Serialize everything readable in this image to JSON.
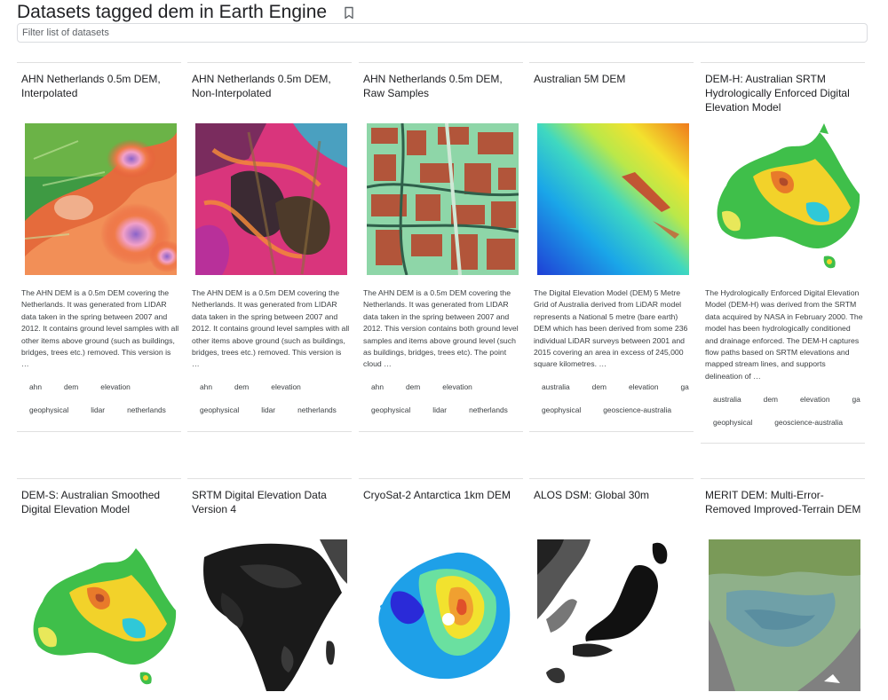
{
  "page": {
    "title": "Datasets tagged dem in Earth Engine"
  },
  "filter": {
    "placeholder": "Filter list of datasets"
  },
  "cards": [
    {
      "title": "AHN Netherlands 0.5m DEM, Interpolated",
      "description": "The AHN DEM is a 0.5m DEM covering the Netherlands. It was generated from LIDAR data taken in the spring between 2007 and 2012. It contains ground level samples with all other items above ground (such as buildings, bridges, trees etc.) removed. This version is …",
      "tags": [
        "ahn",
        "dem",
        "elevation",
        "geophysical",
        "lidar",
        "netherlands"
      ]
    },
    {
      "title": "AHN Netherlands 0.5m DEM, Non-Interpolated",
      "description": "The AHN DEM is a 0.5m DEM covering the Netherlands. It was generated from LIDAR data taken in the spring between 2007 and 2012. It contains ground level samples with all other items above ground (such as buildings, bridges, trees etc.) removed. This version is …",
      "tags": [
        "ahn",
        "dem",
        "elevation",
        "geophysical",
        "lidar",
        "netherlands"
      ]
    },
    {
      "title": "AHN Netherlands 0.5m DEM, Raw Samples",
      "description": "The AHN DEM is a 0.5m DEM covering the Netherlands. It was generated from LIDAR data taken in the spring between 2007 and 2012. This version contains both ground level samples and items above ground level (such as buildings, bridges, trees etc). The point cloud …",
      "tags": [
        "ahn",
        "dem",
        "elevation",
        "geophysical",
        "lidar",
        "netherlands"
      ]
    },
    {
      "title": "Australian 5M DEM",
      "description": "The Digital Elevation Model (DEM) 5 Metre Grid of Australia derived from LiDAR model represents a National 5 metre (bare earth) DEM which has been derived from some 236 individual LiDAR surveys between 2001 and 2015 covering an area in excess of 245,000 square kilometres. …",
      "tags": [
        "australia",
        "dem",
        "elevation",
        "ga",
        "geophysical",
        "geoscience-australia"
      ]
    },
    {
      "title": "DEM-H: Australian SRTM Hydrologically Enforced Digital Elevation Model",
      "description": "The Hydrologically Enforced Digital Elevation Model (DEM-H) was derived from the SRTM data acquired by NASA in February 2000. The model has been hydrologically conditioned and drainage enforced. The DEM-H captures flow paths based on SRTM elevations and mapped stream lines, and supports delineation of …",
      "tags": [
        "australia",
        "dem",
        "elevation",
        "ga",
        "geophysical",
        "geoscience-australia"
      ]
    },
    {
      "title": "DEM-S: Australian Smoothed Digital Elevation Model"
    },
    {
      "title": "SRTM Digital Elevation Data Version 4"
    },
    {
      "title": "CryoSat-2 Antarctica 1km DEM"
    },
    {
      "title": "ALOS DSM: Global 30m"
    },
    {
      "title": "MERIT DEM: Multi-Error-Removed Improved-Terrain DEM"
    }
  ]
}
